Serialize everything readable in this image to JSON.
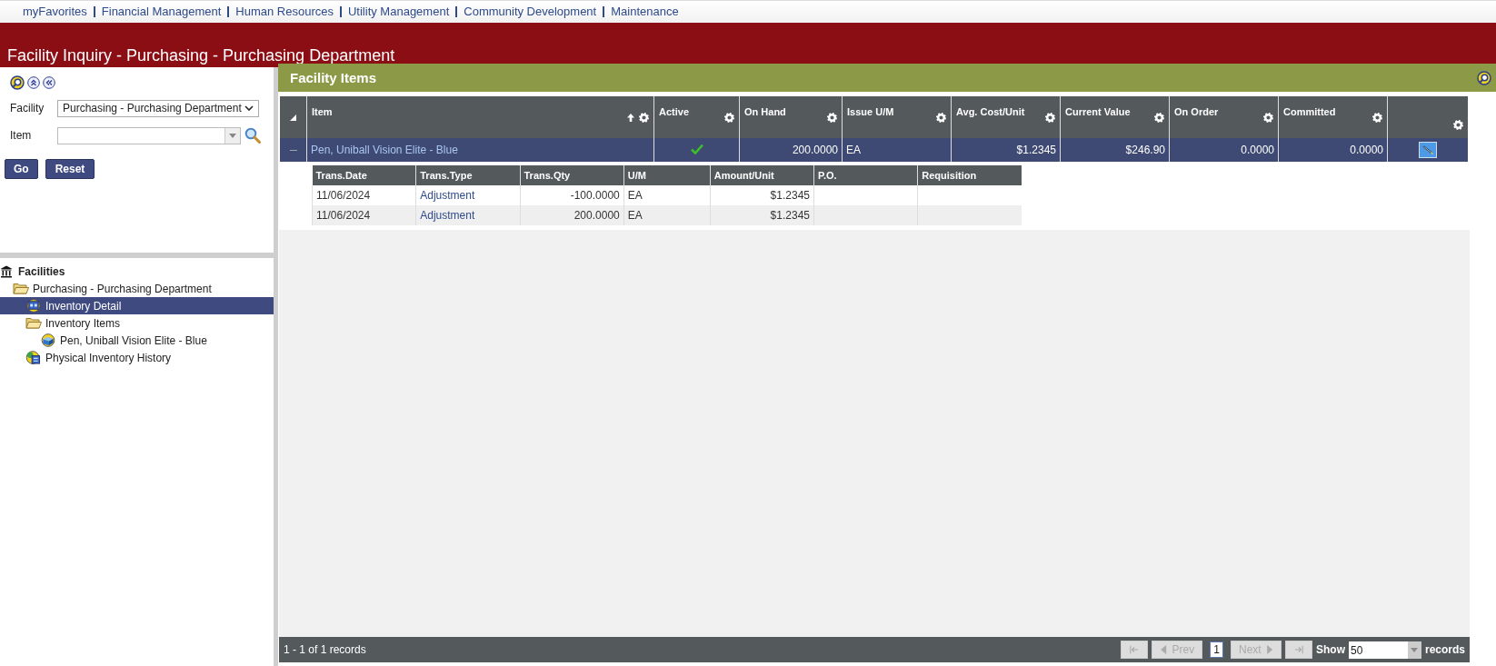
{
  "nav_links": [
    "myFavorites",
    "Financial Management",
    "Human Resources",
    "Utility Management",
    "Community Development",
    "Maintenance"
  ],
  "page_title": "Facility Inquiry - Purchasing - Purchasing Department",
  "search_panel": {
    "fields": [
      {
        "kind": "select",
        "label": "Facility",
        "value": "Purchasing - Purchasing Department"
      },
      {
        "kind": "combo",
        "label": "Item"
      }
    ],
    "buttons": [
      "Go",
      "Reset"
    ]
  },
  "tree": {
    "root": "Facilities",
    "children": [
      {
        "label": "Purchasing - Purchasing Department",
        "kind": "folder",
        "selected": false,
        "children": [
          {
            "label": "Inventory Detail",
            "kind": "detail",
            "selected": true
          },
          {
            "label": "Inventory Items",
            "kind": "folder",
            "selected": false,
            "children": [
              {
                "label": "Pen, Uniball Vision Elite - Blue",
                "kind": "item",
                "selected": false
              }
            ]
          },
          {
            "label": "Physical Inventory History",
            "kind": "history",
            "selected": false
          }
        ]
      }
    ]
  },
  "grid": {
    "title": "Facility Items",
    "columns": [
      {
        "kind": "data",
        "label": "Item",
        "sorted": true
      },
      {
        "kind": "data",
        "label": "Active"
      },
      {
        "kind": "data",
        "label": "On Hand"
      },
      {
        "kind": "data",
        "label": "Issue U/M"
      },
      {
        "kind": "data",
        "label": "Avg. Cost/Unit"
      },
      {
        "kind": "data",
        "label": "Current Value"
      },
      {
        "kind": "data",
        "label": "On Order"
      },
      {
        "kind": "data",
        "label": "Committed"
      },
      {
        "kind": "action"
      }
    ],
    "rows": [
      {
        "expanded": true,
        "selected": true,
        "cells": [
          {
            "kind": "link",
            "text": "Pen, Uniball Vision Elite - Blue"
          },
          {
            "kind": "check",
            "checked": true
          },
          {
            "kind": "number",
            "text": "200.0000"
          },
          {
            "kind": "text",
            "text": "EA"
          },
          {
            "kind": "number",
            "text": "$1.2345"
          },
          {
            "kind": "number",
            "text": "$246.90"
          },
          {
            "kind": "number",
            "text": "0.0000"
          },
          {
            "kind": "number",
            "text": "0.0000"
          },
          {
            "kind": "action"
          }
        ],
        "details": {
          "columns": [
            "Trans.Date",
            "Trans.Type",
            "Trans.Qty",
            "U/M",
            "Amount/Unit",
            "P.O.",
            "Requisition"
          ],
          "rows": [
            [
              {
                "kind": "text",
                "text": "11/06/2024"
              },
              {
                "kind": "link",
                "text": "Adjustment"
              },
              {
                "kind": "number",
                "text": "-100.0000"
              },
              {
                "kind": "text",
                "text": "EA"
              },
              {
                "kind": "number",
                "text": "$1.2345"
              },
              {
                "kind": "empty"
              },
              {
                "kind": "empty"
              }
            ],
            [
              {
                "kind": "text",
                "text": "11/06/2024"
              },
              {
                "kind": "link",
                "text": "Adjustment"
              },
              {
                "kind": "number",
                "text": "200.0000"
              },
              {
                "kind": "text",
                "text": "EA"
              },
              {
                "kind": "number",
                "text": "$1.2345"
              },
              {
                "kind": "empty"
              },
              {
                "kind": "empty"
              }
            ]
          ]
        }
      }
    ],
    "footer": {
      "summary": "1 - 1 of 1 records",
      "pager": {
        "prev": {
          "label": "Prev",
          "disabled": true
        },
        "page": "1",
        "next": {
          "label": "Next",
          "disabled": true
        },
        "first_disabled": true,
        "last_disabled": true,
        "show_label": "Show",
        "page_size": "50",
        "records_label": "records"
      }
    }
  }
}
